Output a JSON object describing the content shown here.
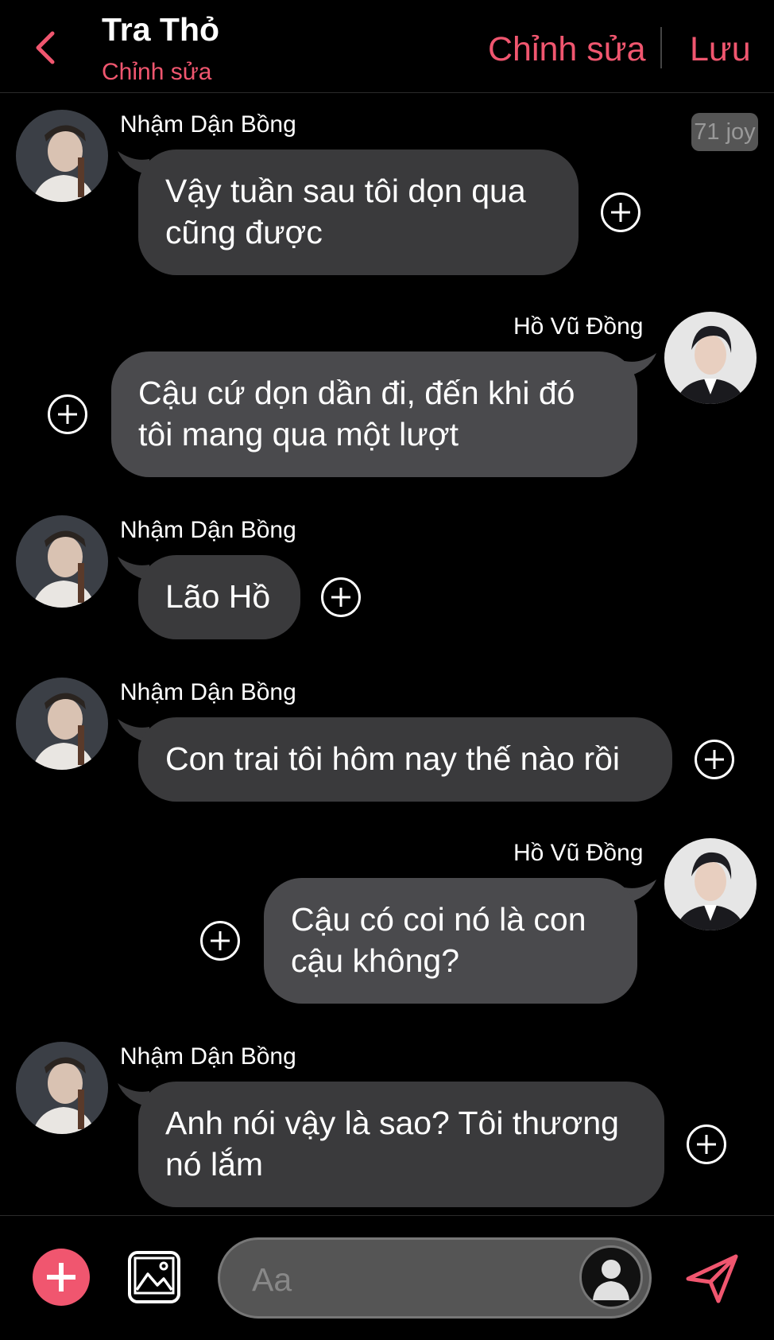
{
  "header": {
    "title": "Tra Thỏ",
    "subtitle": "Chỉnh sửa",
    "edit_label": "Chỉnh sửa",
    "save_label": "Lưu"
  },
  "badge": "71 joy",
  "messages": [
    {
      "sender": "Nhậm Dận Bồng",
      "side": "left",
      "text": "Vậy tuần sau tôi dọn qua\ncũng được"
    },
    {
      "sender": "Hồ Vũ Đồng",
      "side": "right",
      "text": "Cậu cứ dọn dần đi, đến khi đó\ntôi mang qua một lượt"
    },
    {
      "sender": "Nhậm Dận Bồng",
      "side": "left",
      "text": "Lão Hồ"
    },
    {
      "sender": "Nhậm Dận Bồng",
      "side": "left",
      "text": "Con trai tôi hôm nay thế nào rồi"
    },
    {
      "sender": "Hồ Vũ Đồng",
      "side": "right",
      "text": "Cậu có coi nó là con\ncậu không?"
    },
    {
      "sender": "Nhậm Dận Bồng",
      "side": "left",
      "text": "Anh nói vậy là sao? Tôi thương\nnó lắm"
    }
  ],
  "composer": {
    "placeholder": "Aa"
  },
  "colors": {
    "accent": "#f0566f",
    "bubble_left": "#3a3a3c",
    "bubble_right": "#4a4a4d",
    "background": "#000000"
  },
  "icons": [
    "back-icon",
    "plus-circle-icon",
    "image-icon",
    "send-icon",
    "avatar-icon"
  ]
}
